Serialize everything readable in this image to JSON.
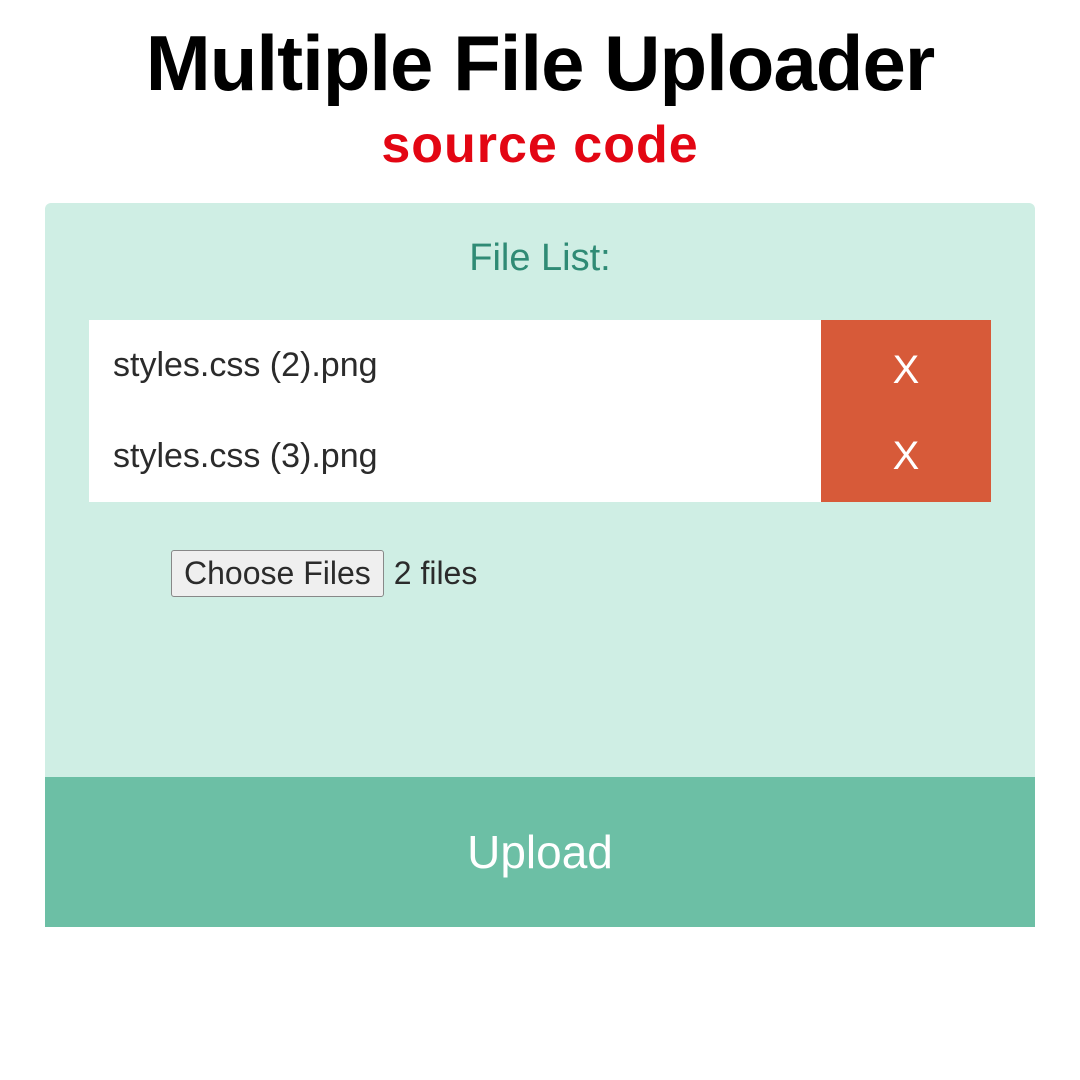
{
  "heading": {
    "title": "Multiple File Uploader",
    "subtitle": "source code"
  },
  "panel": {
    "file_list_title": "File List:",
    "files": [
      {
        "name": "styles.css (2).png",
        "remove_label": "X"
      },
      {
        "name": "styles.css (3).png",
        "remove_label": "X"
      }
    ],
    "choose_button_label": "Choose Files",
    "file_count_text": "2 files",
    "upload_button_label": "Upload"
  }
}
